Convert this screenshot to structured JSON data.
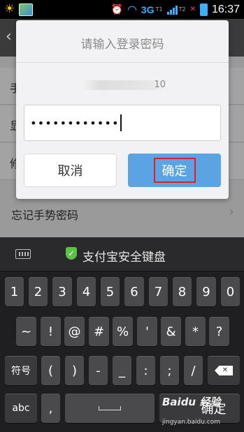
{
  "status_bar": {
    "network": "3G",
    "carrier_slot": "T1",
    "signal_slot2": "T2",
    "time": "16:37"
  },
  "background_page": {
    "row_labels": [
      "手",
      "显",
      "修"
    ],
    "forgot_gesture_label": "忘记手势密码"
  },
  "dialog": {
    "title": "请输入登录密码",
    "account_masked": "10",
    "password_mask": "••••••••••••",
    "cancel_label": "取消",
    "confirm_label": "确定"
  },
  "keyboard": {
    "title": "支付宝安全键盘",
    "row1": [
      "1",
      "2",
      "3",
      "4",
      "5",
      "6",
      "7",
      "8",
      "9",
      "0"
    ],
    "row2": [
      "~",
      "!",
      "@",
      "#",
      "%",
      "'",
      "&",
      "*",
      "?"
    ],
    "row3": [
      "(",
      ")",
      "-",
      "_",
      ":",
      ";",
      "/"
    ],
    "symbol_key": "符号",
    "abc_key": "abc",
    "comma_key": ",",
    "confirm_key": "确定"
  },
  "watermark": {
    "brand": "Baidu 经验",
    "url": "jingyan.baidu.com"
  },
  "colors": {
    "accent": "#5aa4e4",
    "highlight": "#e02020",
    "shield": "#5cc24a"
  }
}
